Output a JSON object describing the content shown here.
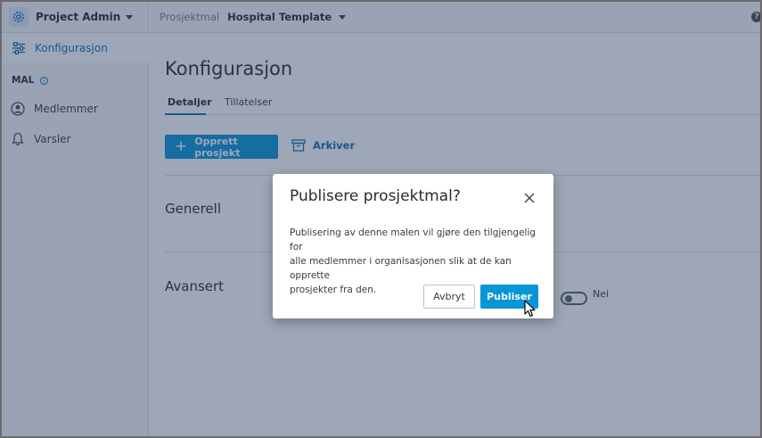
{
  "header": {
    "app_name": "Project Admin",
    "breadcrumb_label": "Prosjektmal",
    "breadcrumb_value": "Hospital Template",
    "help_glyph": "?"
  },
  "sidebar": {
    "active_item": "Konfigurasjon",
    "section_label": "MAL",
    "info_glyph": "i",
    "items": [
      {
        "label": "Medlemmer",
        "icon": "user-icon"
      },
      {
        "label": "Varsler",
        "icon": "bell-icon"
      }
    ]
  },
  "main": {
    "title": "Konfigurasjon",
    "tabs": [
      {
        "label": "Detaljer",
        "active": true
      },
      {
        "label": "Tillatelser",
        "active": false
      }
    ],
    "create_button": "Opprett prosjekt",
    "archive_button": "Arkiver",
    "sections": [
      "Generell",
      "Avansert"
    ],
    "toggle_label": "Nei",
    "toggle_on": false
  },
  "modal": {
    "title": "Publisere prosjektmal?",
    "body_lines": [
      "Publisering av denne malen vil gjøre den tilgjengelig for",
      "alle medlemmer i organisasjonen slik at de kan opprette",
      "prosjekter fra den."
    ],
    "cancel_label": "Avbryt",
    "publish_label": "Publiser"
  },
  "colors": {
    "accent": "#0696d7",
    "link": "#0e6fb8",
    "overlay": "#283c5f"
  }
}
